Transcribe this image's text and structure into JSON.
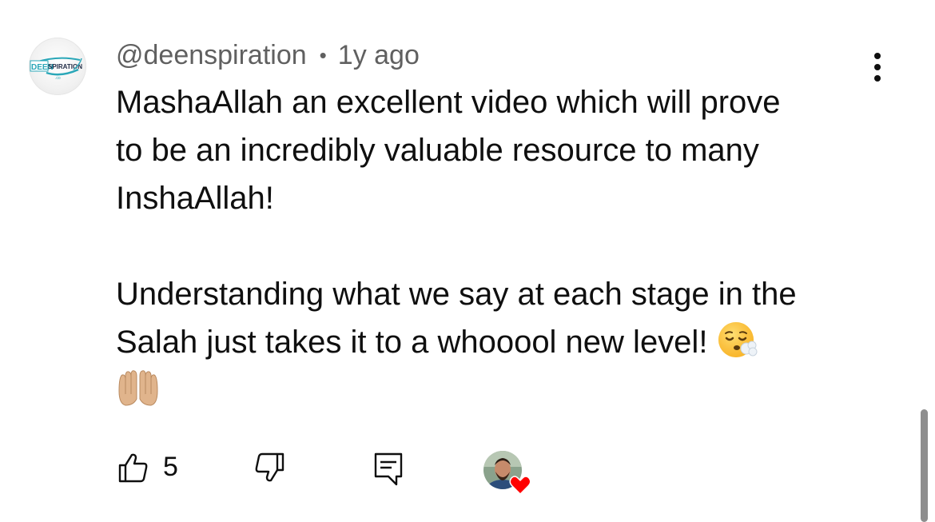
{
  "comment": {
    "channel_avatar_text": {
      "left": "DEEN",
      "right": "SPIRATION"
    },
    "author": "@deenspiration",
    "separator": "•",
    "time": "1y ago",
    "paragraph1": "MashaAllah an excellent video which will prove\nto be an incredibly valuable resource to many\nInshaAllah!",
    "paragraph2": "Understanding what we say at each stage in the\nSalah just takes it to a whooool new level!",
    "emoji_1": "exhaling-face",
    "emoji_2": "palms-up-together-medium-light-skin",
    "like_count": "5"
  },
  "icons": {
    "more": "more-vertical-icon",
    "like": "thumbs-up-icon",
    "dislike": "thumbs-down-icon",
    "reply": "reply-comment-icon",
    "creator_heart": "heart-icon"
  },
  "colors": {
    "text_primary": "#0f0f0f",
    "text_secondary": "#606060",
    "heart": "#ff0000",
    "logo_teal": "#2aa7b8"
  }
}
